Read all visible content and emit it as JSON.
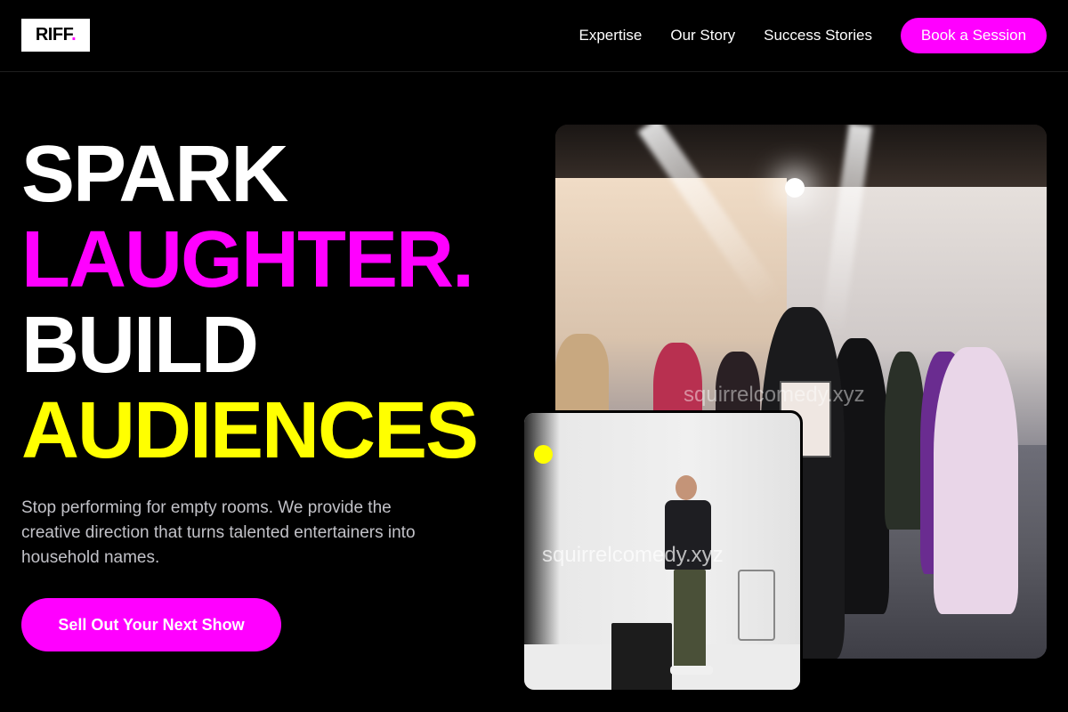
{
  "brand": {
    "logo_text": "RIFF",
    "logo_dot": ".",
    "accent_magenta": "#ff00ff",
    "accent_yellow": "#ffff00"
  },
  "nav": {
    "items": [
      {
        "label": "Expertise"
      },
      {
        "label": "Our Story"
      },
      {
        "label": "Success Stories"
      }
    ],
    "cta_label": "Book a Session"
  },
  "hero": {
    "headline": {
      "line1": "SPARK",
      "line2": "LAUGHTER.",
      "line3": "BUILD",
      "line4": "AUDIENCES"
    },
    "subcopy": "Stop performing for empty rooms. We provide the creative direction that turns talented entertainers into household names.",
    "cta_label": "Sell Out Your Next Show"
  },
  "images": {
    "main_watermark": "squirrelcomedy.xyz",
    "small_watermark": "squirrelcomedy.xyz"
  }
}
